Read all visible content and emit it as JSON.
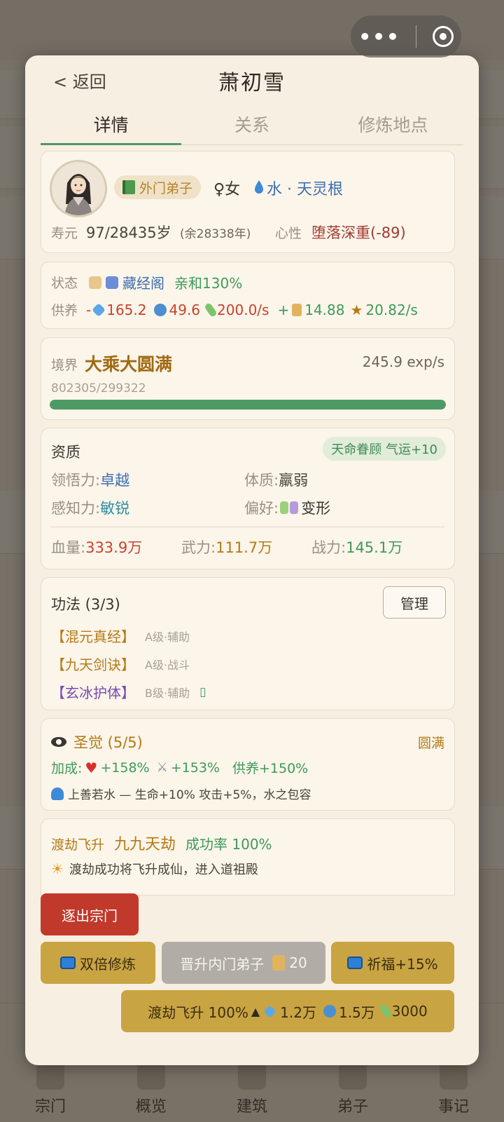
{
  "background": {
    "nav": [
      "宗门",
      "概览",
      "建筑",
      "弟子",
      "事记"
    ]
  },
  "header": {
    "back_label": "< 返回",
    "title": "萧初雪"
  },
  "tabs": [
    "详情",
    "关系",
    "修炼地点"
  ],
  "profile": {
    "role": "外门弟子",
    "gender": "♀女",
    "element": "水 · 天灵根",
    "lifespan_label": "寿元",
    "lifespan_value": "97/28435岁",
    "lifespan_remaining": "(余28338年)",
    "mind_label": "心性",
    "mind_value": "堕落深重(-89)"
  },
  "status": {
    "state_label": "状态",
    "location": "藏经阁",
    "affinity": "亲和130%",
    "supply_label": "供养",
    "supply": {
      "prefix": "-",
      "gem": "165.2",
      "spiral": "49.6",
      "pill": "200.0/s",
      "plus": "+",
      "scroll": "14.88",
      "star": "20.82/s"
    }
  },
  "realm": {
    "label": "境界",
    "value": "大乘大圆满",
    "rate": "245.9 exp/s",
    "exp": "802305/299322",
    "progress": 1.0
  },
  "aptitude": {
    "title": "资质",
    "luck_badge": "天命眷顾 气运+10",
    "comprehension_label": "领悟力:",
    "comprehension_value": "卓越",
    "physique_label": "体质:",
    "physique_value": "羸弱",
    "perception_label": "感知力:",
    "perception_value": "敏锐",
    "preference_label": "偏好:",
    "preference_value": "变形",
    "hp_label": "血量:",
    "hp_value": "333.9万",
    "force_label": "武力:",
    "force_value": "111.7万",
    "power_label": "战力:",
    "power_value": "145.1万"
  },
  "skills": {
    "title": "功法 (3/3)",
    "manage_label": "管理",
    "items": [
      {
        "name": "【混元真经】",
        "grade": "A级·辅助"
      },
      {
        "name": "【九天剑诀】",
        "grade": "A级·战斗"
      },
      {
        "name": "【玄冰护体】",
        "grade": "B级·辅助"
      }
    ],
    "extra_glyph": "▯"
  },
  "insight": {
    "title": "圣觉 (5/5)",
    "full_tag": "圆满",
    "bonus_label": "加成:",
    "bonus_hp": "+158%",
    "bonus_atk": "+153%",
    "bonus_supply": "供养+150%",
    "note": "上善若水 — 生命+10% 攻击+5%，水之包容"
  },
  "tribulation": {
    "label": "渡劫飞升",
    "name": "九九天劫",
    "rate": "成功率 100%",
    "note": "渡劫成功将飞升成仙，进入道祖殿"
  },
  "actions": {
    "expel": "逐出宗门",
    "double_cultivate": "双倍修炼",
    "promote": "晋升内门弟子",
    "promote_cost": "20",
    "bless": "祈福+15%",
    "ascend": "渡劫飞升 100%",
    "ascend_gem": "1.2万",
    "ascend_spiral": "1.5万",
    "ascend_pill": "3000"
  }
}
